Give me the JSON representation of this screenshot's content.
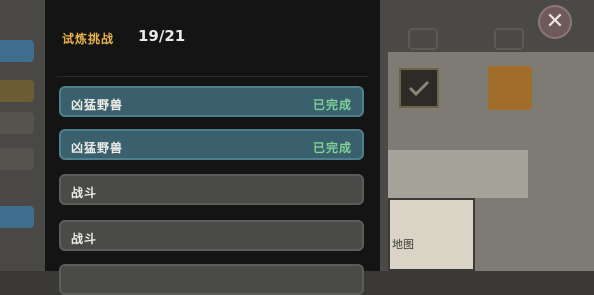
{
  "background": {
    "left_tabs": [
      "",
      "",
      "",
      "",
      ""
    ],
    "map_label": "地图"
  },
  "close_button": {
    "icon": "close-icon",
    "glyph": "✕"
  },
  "modal": {
    "title": "试炼挑战",
    "progress": "19/21",
    "tasks": [
      {
        "label": "凶猛野兽",
        "status": "已完成",
        "state": "done"
      },
      {
        "label": "凶猛野兽",
        "status": "已完成",
        "state": "done"
      },
      {
        "label": "战斗",
        "status": "",
        "state": "pending"
      },
      {
        "label": "战斗",
        "status": "",
        "state": "pending"
      },
      {
        "label": "",
        "status": "",
        "state": "pending"
      }
    ]
  },
  "colors": {
    "title": "#e5b04a",
    "done_bg": "#3a5f6d",
    "done_status": "#7fd196",
    "pending_bg": "#4a4a48"
  }
}
